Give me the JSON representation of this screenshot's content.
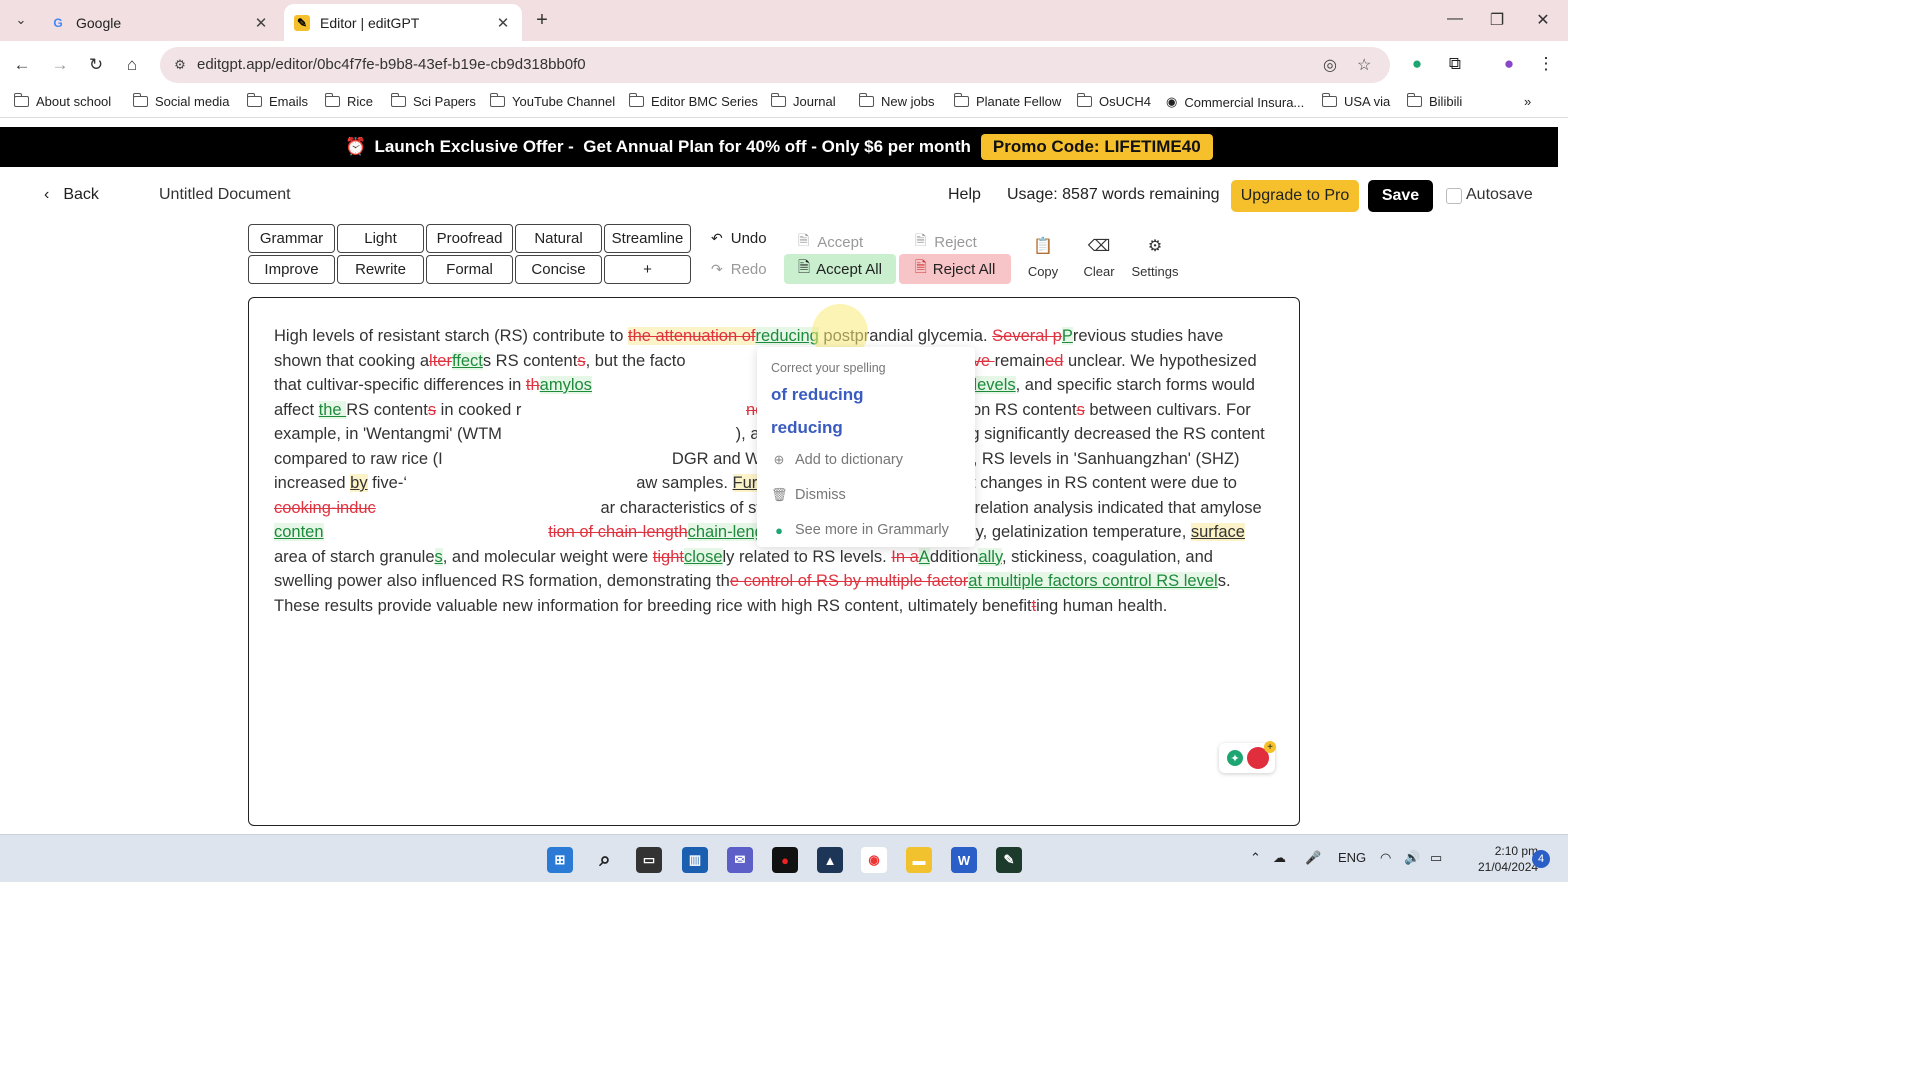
{
  "browser": {
    "tabs": [
      {
        "title": "Google",
        "favicon": "G"
      },
      {
        "title": "Editor | editGPT",
        "favicon": "✎"
      }
    ],
    "url": "editgpt.app/editor/0bc4f7fe-b9b8-43ef-b19e-cb9d318bb0f0",
    "bookmarks": [
      "About school",
      "Social media",
      "Emails",
      "Rice",
      "Sci Papers",
      "YouTube Channel",
      "Editor BMC Series",
      "Journal",
      "New jobs",
      "Planate Fellow",
      "OsUCH4",
      "Commercial Insura...",
      "USA via",
      "Bilibili"
    ]
  },
  "promo": {
    "icon": "⏰",
    "text": "Launch Exclusive Offer -  Get Annual Plan for 40% off - Only $6 per month",
    "code": "Promo Code: LIFETIME40"
  },
  "header": {
    "back": "Back",
    "doc_title": "Untitled Document",
    "help": "Help",
    "usage": "Usage: 8587 words remaining",
    "upgrade": "Upgrade to Pro",
    "save": "Save",
    "autosave": "Autosave"
  },
  "toolbar": {
    "modes_row1": [
      "Grammar",
      "Light",
      "Proofread",
      "Natural",
      "Streamline"
    ],
    "modes_row2": [
      "Improve",
      "Rewrite",
      "Formal",
      "Concise",
      "+"
    ],
    "undo": "Undo",
    "redo": "Redo",
    "accept": "Accept",
    "reject": "Reject",
    "accept_all": "Accept All",
    "reject_all": "Reject All",
    "copy": "Copy",
    "clear": "Clear",
    "settings": "Settings"
  },
  "popup": {
    "header": "Correct your spelling",
    "suggestions": [
      "of reducing",
      "reducing"
    ],
    "add_dictionary": "Add to dictionary",
    "dismiss": "Dismiss",
    "see_more": "See more in Grammarly"
  },
  "taskbar": {
    "lang": "ENG",
    "time": "2:10 pm",
    "date": "21/04/2024",
    "notifications": "4"
  }
}
